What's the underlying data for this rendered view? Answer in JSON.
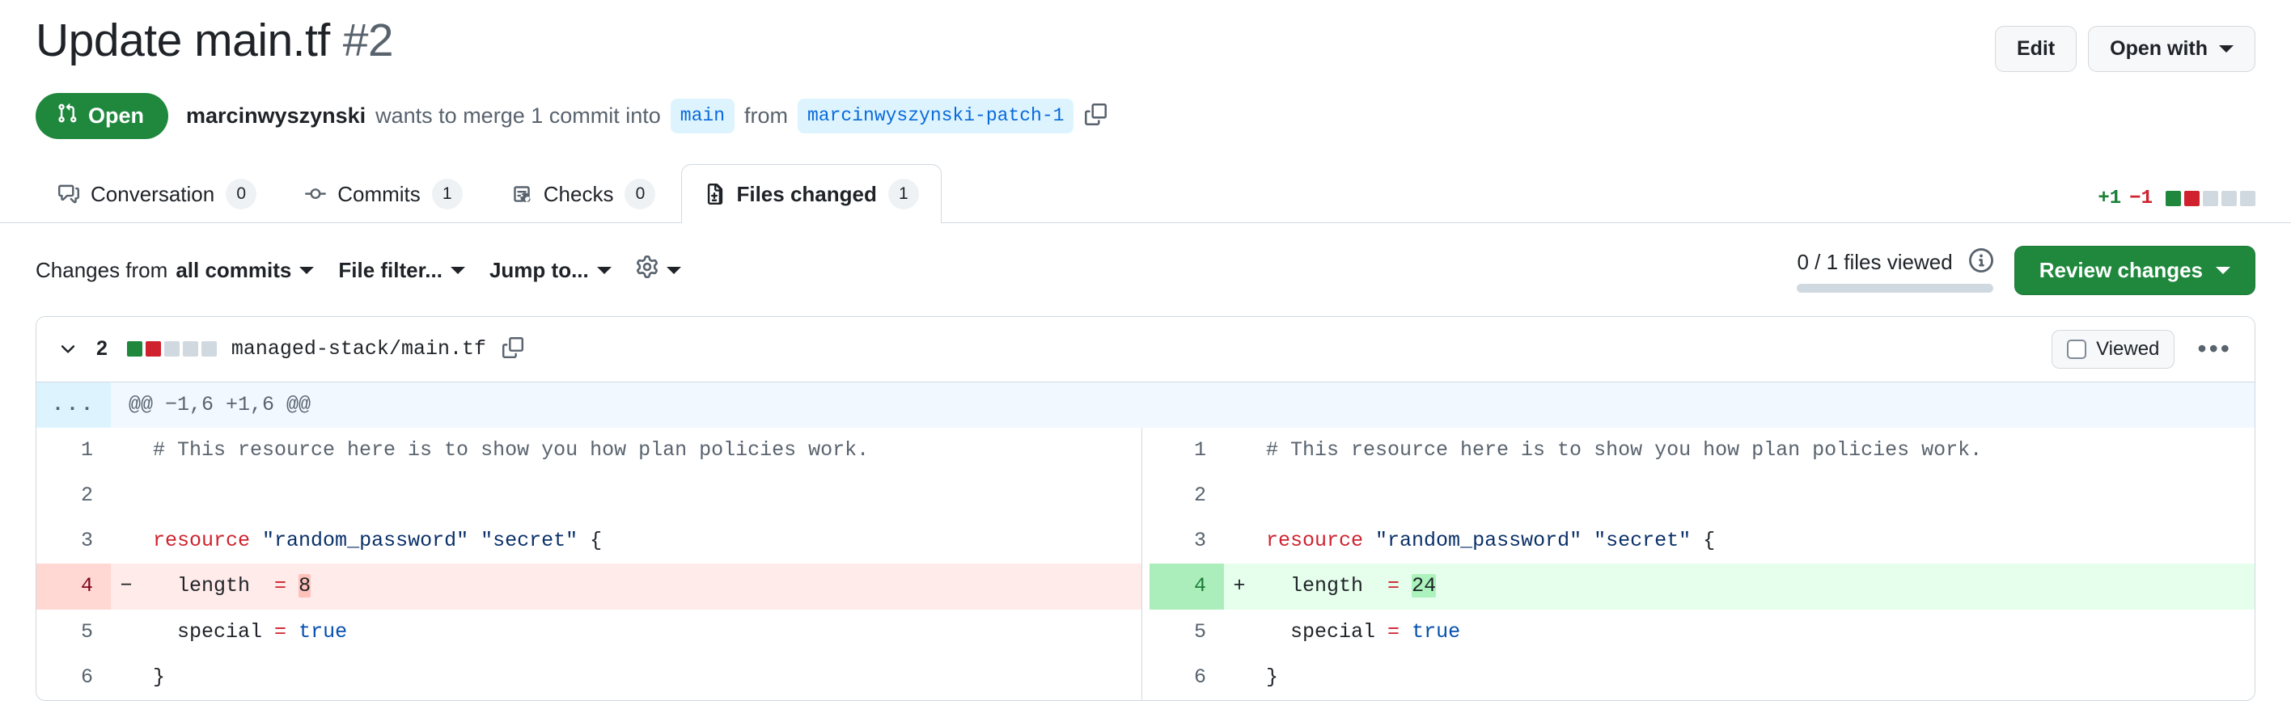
{
  "header": {
    "title": "Update main.tf",
    "number": "#2",
    "edit_label": "Edit",
    "open_with_label": "Open with"
  },
  "state": {
    "badge_label": "Open",
    "badge_color": "#1f883d",
    "author": "marcinwyszynski",
    "text_before": "wants to merge 1 commit into",
    "base_branch": "main",
    "text_middle": "from",
    "head_branch": "marcinwyszynski-patch-1"
  },
  "tabs": [
    {
      "label": "Conversation",
      "count": "0",
      "icon": "comment-discussion-icon",
      "active": false
    },
    {
      "label": "Commits",
      "count": "1",
      "icon": "git-commit-icon",
      "active": false
    },
    {
      "label": "Checks",
      "count": "0",
      "icon": "checklist-icon",
      "active": false
    },
    {
      "label": "Files changed",
      "count": "1",
      "icon": "file-diff-icon",
      "active": true
    }
  ],
  "diffstat_top": {
    "additions": "+1",
    "deletions": "−1",
    "blocks": [
      "add",
      "del",
      "neutral",
      "neutral",
      "neutral"
    ],
    "add_color": "#1a7f37",
    "del_color": "#cf222e"
  },
  "toolbar": {
    "changes_from_prefix": "Changes from",
    "changes_from_value": "all commits",
    "file_filter_label": "File filter...",
    "jump_to_label": "Jump to...",
    "settings_icon": "gear-icon",
    "files_viewed": "0 / 1 files viewed",
    "info_icon": "info-icon",
    "progress_percent": 0,
    "review_changes_label": "Review changes"
  },
  "file": {
    "changes_count": "2",
    "blocks": [
      "add",
      "del",
      "neutral",
      "neutral",
      "neutral"
    ],
    "path": "managed-stack/main.tf",
    "copy_icon": "copy-icon",
    "viewed_label": "Viewed",
    "viewed_checked": false,
    "kebab_label": "•••"
  },
  "hunk": {
    "expander": "...",
    "header": "@@ −1,6 +1,6 @@"
  },
  "diff_rows": [
    {
      "type": "context",
      "left_num": "1",
      "left_sign": "",
      "left_code_html": "<span class=\"tok-com\"># This resource here is to show you how plan policies work.</span>",
      "right_num": "1",
      "right_sign": "",
      "right_code_html": "<span class=\"tok-com\"># This resource here is to show you how plan policies work.</span>"
    },
    {
      "type": "context",
      "left_num": "2",
      "left_sign": "",
      "left_code_html": "",
      "right_num": "2",
      "right_sign": "",
      "right_code_html": ""
    },
    {
      "type": "context",
      "left_num": "3",
      "left_sign": "",
      "left_code_html": "<span class=\"tok-kw\">resource</span> <span class=\"tok-str\">\"random_password\"</span> <span class=\"tok-str\">\"secret\"</span> {",
      "right_num": "3",
      "right_sign": "",
      "right_code_html": "<span class=\"tok-kw\">resource</span> <span class=\"tok-str\">\"random_password\"</span> <span class=\"tok-str\">\"secret\"</span> {"
    },
    {
      "type": "change",
      "left_num": "4",
      "left_sign": "−",
      "left_code_html": "  length  <span class=\"tok-op\">=</span> <span class=\"hl-del\">8</span>",
      "right_num": "4",
      "right_sign": "+",
      "right_code_html": "  length  <span class=\"tok-op\">=</span> <span class=\"hl-add\">24</span>"
    },
    {
      "type": "context",
      "left_num": "5",
      "left_sign": "",
      "left_code_html": "  special <span class=\"tok-op\">=</span> <span class=\"tok-bool\">true</span>",
      "right_num": "5",
      "right_sign": "",
      "right_code_html": "  special <span class=\"tok-op\">=</span> <span class=\"tok-bool\">true</span>"
    },
    {
      "type": "context",
      "left_num": "6",
      "left_sign": "",
      "left_code_html": "}",
      "right_num": "6",
      "right_sign": "",
      "right_code_html": "}"
    }
  ]
}
